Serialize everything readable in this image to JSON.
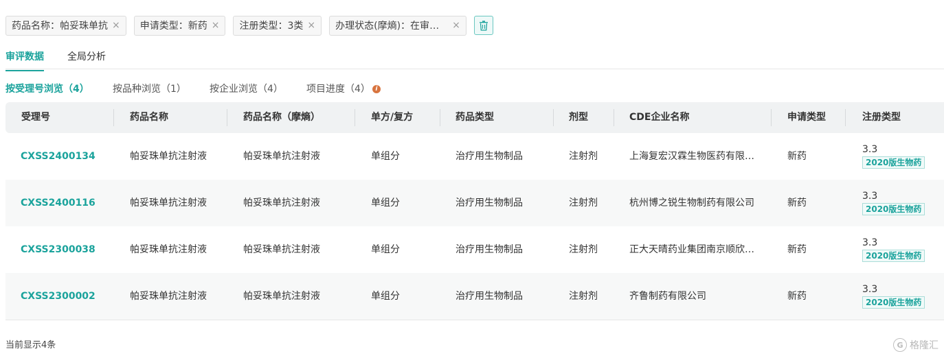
{
  "filters": [
    {
      "label": "药品名称：帕妥珠单抗"
    },
    {
      "label": "申请类型：新药"
    },
    {
      "label": "注册类型：3类"
    },
    {
      "label": "办理状态(摩熵)：在审评中,在审批中,审批完毕-待制证"
    }
  ],
  "filter_close_glyph": "×",
  "main_tabs": [
    {
      "label": "审评数据"
    },
    {
      "label": "全局分析"
    }
  ],
  "sub_tabs": [
    {
      "label": "按受理号浏览（4）"
    },
    {
      "label": "按品种浏览（1）"
    },
    {
      "label": "按企业浏览（4）"
    },
    {
      "label": "项目进度（4）"
    }
  ],
  "info_icon_glyph": "i",
  "table": {
    "columns": [
      "受理号",
      "药品名称",
      "药品名称（摩熵）",
      "单方/复方",
      "药品类型",
      "剂型",
      "CDE企业名称",
      "申请类型",
      "注册类型"
    ],
    "rows": [
      {
        "code": "CXSS2400134",
        "name": "帕妥珠单抗注射液",
        "name_ms": "帕妥珠单抗注射液",
        "composition": "单组分",
        "drug_type": "治疗用生物制品",
        "form": "注射剂",
        "company": "上海复宏汉霖生物医药有限公司",
        "app_type": "新药",
        "reg_num": "3.3",
        "reg_tag": "2020版生物药"
      },
      {
        "code": "CXSS2400116",
        "name": "帕妥珠单抗注射液",
        "name_ms": "帕妥珠单抗注射液",
        "composition": "单组分",
        "drug_type": "治疗用生物制品",
        "form": "注射剂",
        "company": "杭州博之锐生物制药有限公司",
        "app_type": "新药",
        "reg_num": "3.3",
        "reg_tag": "2020版生物药"
      },
      {
        "code": "CXSS2300038",
        "name": "帕妥珠单抗注射液",
        "name_ms": "帕妥珠单抗注射液",
        "composition": "单组分",
        "drug_type": "治疗用生物制品",
        "form": "注射剂",
        "company": "正大天晴药业集团南京顺欣制药有限公司",
        "app_type": "新药",
        "reg_num": "3.3",
        "reg_tag": "2020版生物药"
      },
      {
        "code": "CXSS2300002",
        "name": "帕妥珠单抗注射液",
        "name_ms": "帕妥珠单抗注射液",
        "composition": "单组分",
        "drug_type": "治疗用生物制品",
        "form": "注射剂",
        "company": "齐鲁制药有限公司",
        "app_type": "新药",
        "reg_num": "3.3",
        "reg_tag": "2020版生物药"
      }
    ]
  },
  "footer": {
    "count_text": "当前显示4条"
  },
  "watermark": {
    "text": "格隆汇",
    "logo_glyph": "G"
  },
  "colors": {
    "accent": "#1ba39c",
    "info": "#d8743f"
  }
}
